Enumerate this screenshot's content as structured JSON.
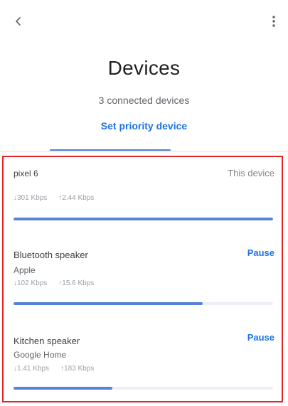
{
  "header": {
    "title": "Devices",
    "subtitle": "3 connected devices",
    "priority_link": "Set priority device"
  },
  "devices": [
    {
      "name": "pixel 6",
      "tag": "This device",
      "download": "↓301 Kbps",
      "upload": "↑2.44 Kbps",
      "usage_fraction": 1.0
    },
    {
      "name": "Bluetooth speaker",
      "subtitle": "Apple",
      "download": "↓102 Kbps",
      "upload": "↑15.6 Kbps",
      "action": "Pause",
      "usage_fraction": 0.73
    },
    {
      "name": "Kitchen speaker",
      "subtitle": "Google Home",
      "download": "↓1.41 Kbps",
      "upload": "↑183 Kbps",
      "action": "Pause",
      "usage_fraction": 0.38
    }
  ],
  "colors": {
    "accent": "#1a73e8",
    "bar": "#5584d6",
    "highlight_border": "#e02424"
  },
  "icons": {
    "back": "arrow-back-icon",
    "more": "more-vert-icon"
  }
}
